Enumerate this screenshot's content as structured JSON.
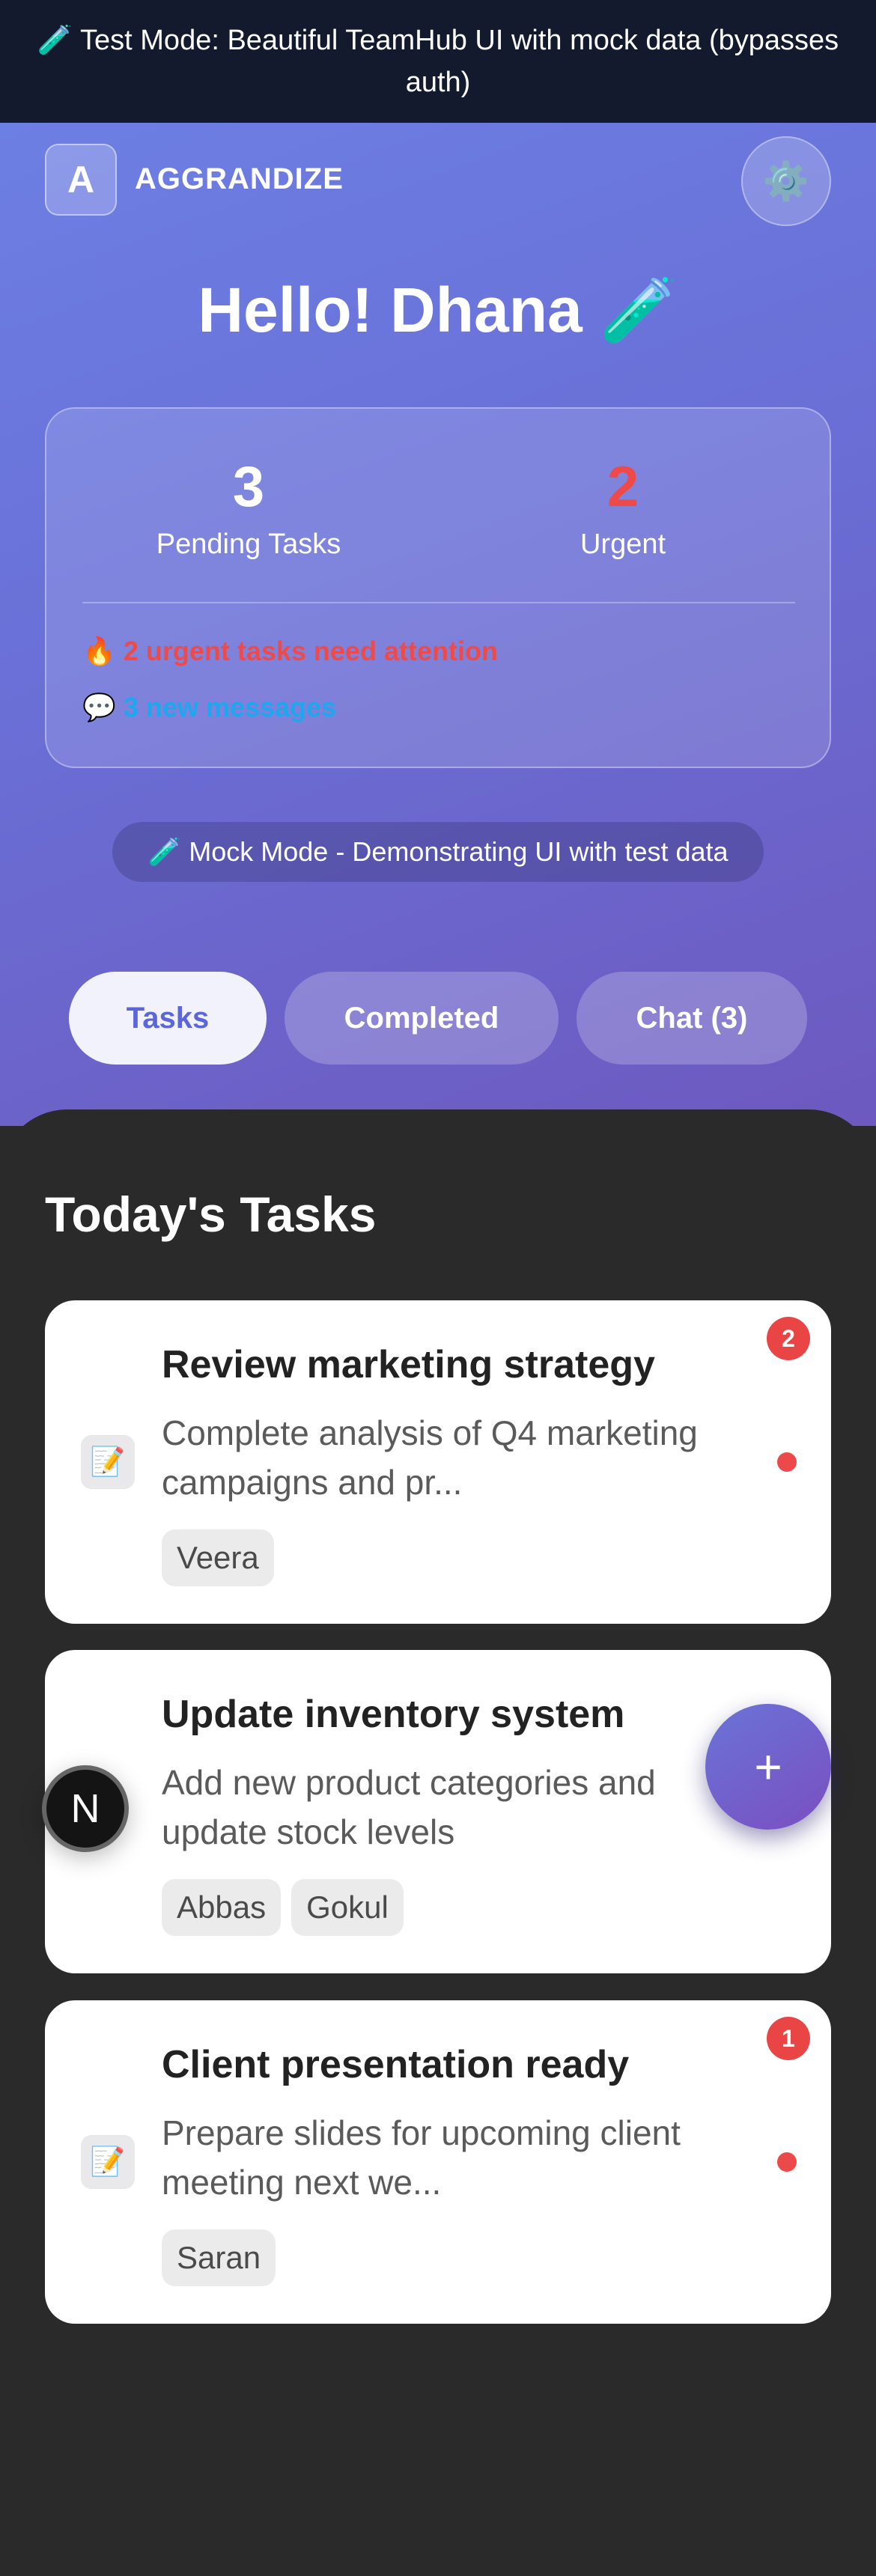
{
  "banner": {
    "text": "🧪 Test Mode: Beautiful TeamHub UI with mock data (bypasses auth)"
  },
  "header": {
    "logo_letter": "A",
    "brand": "AGGRANDIZE",
    "settings_icon": "⚙️"
  },
  "greeting": "Hello! Dhana 🧪",
  "stats": {
    "pending_count": "3",
    "pending_label": "Pending Tasks",
    "urgent_count": "2",
    "urgent_label": "Urgent",
    "urgent_alert": "🔥 2 urgent tasks need attention",
    "messages_alert": "💬 3 new messages"
  },
  "mock_notice": "🧪 Mock Mode - Demonstrating UI with test data",
  "tabs": [
    {
      "label": "Tasks",
      "active": true
    },
    {
      "label": "Completed",
      "active": false
    },
    {
      "label": "Chat (3)",
      "active": false
    }
  ],
  "section_title": "Today's Tasks",
  "tasks": [
    {
      "title": "Review marketing strategy",
      "description": "Complete analysis of Q4 marketing campaigns and pr...",
      "assignees": [
        "Veera"
      ],
      "badge": "2",
      "icon": "📝"
    },
    {
      "title": "Update inventory system",
      "description": "Add new product categories and update stock levels",
      "assignees": [
        "Abbas",
        "Gokul"
      ],
      "badge": "",
      "icon": ""
    },
    {
      "title": "Client presentation ready",
      "description": "Prepare slides for upcoming client meeting next we...",
      "assignees": [
        "Saran"
      ],
      "badge": "1",
      "icon": "📝"
    }
  ],
  "fab": {
    "label": "+"
  },
  "avatar": {
    "letter": "N"
  },
  "colors": {
    "accent": "#5b67d8",
    "urgent": "#ef4a4a",
    "messages": "#1ea7ef",
    "banner_bg": "#141a2e",
    "panel_bg": "#2a2a2a"
  }
}
